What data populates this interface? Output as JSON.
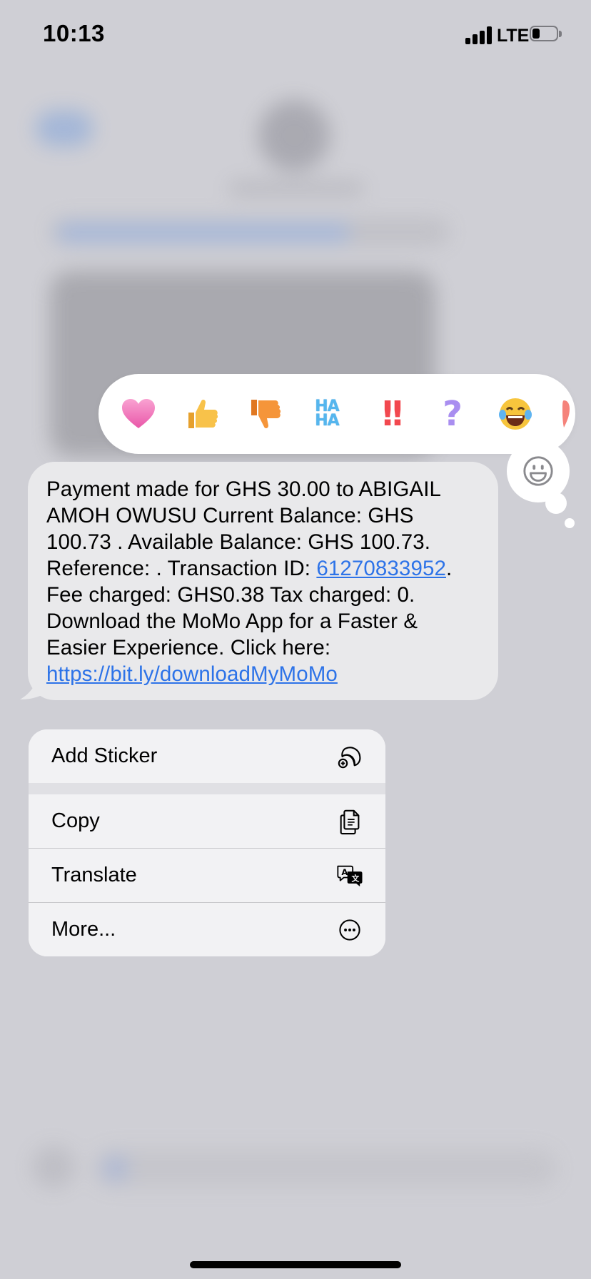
{
  "status_bar": {
    "time": "10:13",
    "network": "LTE"
  },
  "reactions": [
    {
      "name": "heart",
      "glyph": "heart-icon",
      "color": "#ee6fb6"
    },
    {
      "name": "thumbs-up",
      "glyph": "thumbs-up-icon",
      "color": "#f6b73c"
    },
    {
      "name": "thumbs-down",
      "glyph": "thumbs-down-icon",
      "color": "#f08a2c"
    },
    {
      "name": "haha",
      "line1": "HA",
      "line2": "HA",
      "color": "#55b6ee"
    },
    {
      "name": "exclamation",
      "text": "!!",
      "color": "#f2484f"
    },
    {
      "name": "question",
      "text": "?",
      "color": "#a98ef0"
    },
    {
      "name": "laughing",
      "glyph": "😂"
    }
  ],
  "message": {
    "text_before_id": "Payment made for GHS 30.00 to ABIGAIL AMOH OWUSU Current Balance: GHS 100.73 . Available Balance: GHS 100.73. Reference: . Transaction ID: ",
    "transaction_id": "61270833952",
    "text_after_id": ". Fee charged: GHS0.38 Tax charged: 0. Download the MoMo App for a Faster & Easier Experience. Click here: ",
    "link": "https://bit.ly/downloadMyMoMo"
  },
  "menu": {
    "items": [
      {
        "label": "Add Sticker",
        "icon": "sticker-icon"
      },
      {
        "label": "Copy",
        "icon": "copy-icon"
      },
      {
        "label": "Translate",
        "icon": "translate-icon"
      },
      {
        "label": "More...",
        "icon": "more-icon"
      }
    ]
  }
}
